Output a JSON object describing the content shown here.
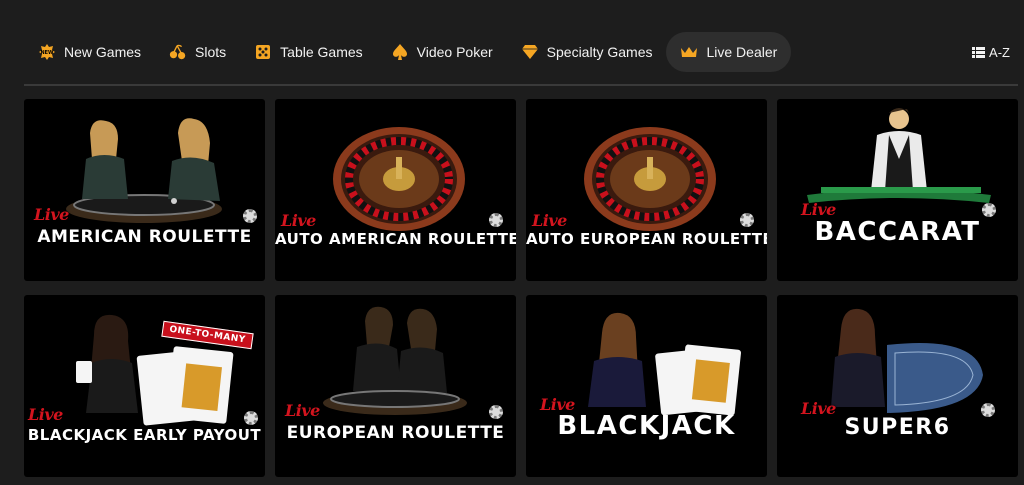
{
  "nav": {
    "items": [
      {
        "label": "New Games",
        "icon": "new-badge-icon"
      },
      {
        "label": "Slots",
        "icon": "cherries-icon"
      },
      {
        "label": "Table Games",
        "icon": "dice-icon"
      },
      {
        "label": "Video Poker",
        "icon": "spade-icon"
      },
      {
        "label": "Specialty Games",
        "icon": "diamond-icon"
      },
      {
        "label": "Live Dealer",
        "icon": "crown-icon",
        "active": true
      }
    ],
    "az_label": "A-Z"
  },
  "games": [
    {
      "live": "Live",
      "title": "AMERICAN ROULETTE"
    },
    {
      "live": "Live",
      "title": "AUTO AMERICAN ROULETTE"
    },
    {
      "live": "Live",
      "title": "AUTO EUROPEAN ROULETTE"
    },
    {
      "live": "Live",
      "title": "BACCARAT"
    },
    {
      "live": "Live",
      "title": "BLACKJACK EARLY PAYOUT",
      "badge": "ONE-TO-MANY"
    },
    {
      "live": "Live",
      "title": "EUROPEAN ROULETTE"
    },
    {
      "live": "Live",
      "title": "BLACKJACK"
    },
    {
      "live": "Live",
      "title": "SUPER6"
    }
  ],
  "colors": {
    "accent": "#f5a623",
    "live_red": "#d3141e",
    "background": "#1d1d1d"
  }
}
